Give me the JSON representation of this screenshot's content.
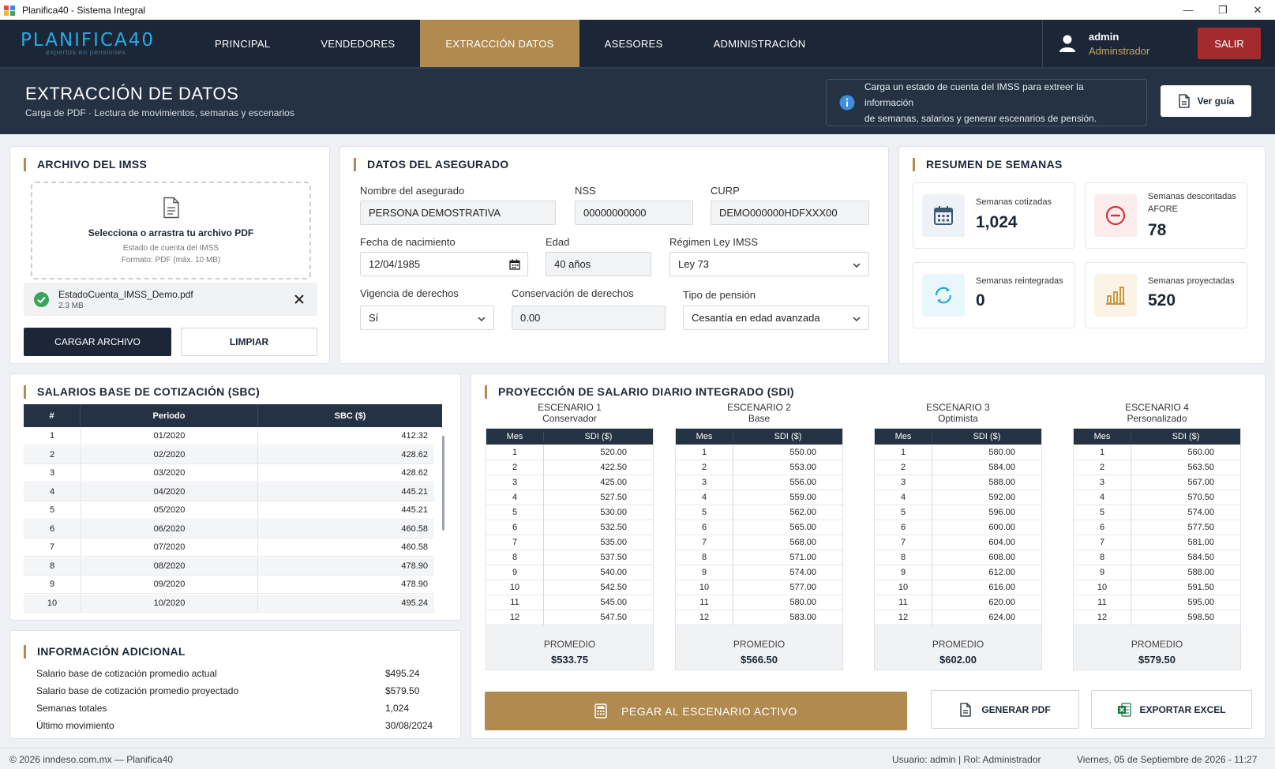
{
  "window": {
    "title": "Planifica40 - Sistema Integral",
    "controls": {
      "minimize": "—",
      "restore": "❐",
      "close": "✕"
    }
  },
  "nav": {
    "logo": "PLANIFICA40",
    "logo_tagline": "expertos en pensiones",
    "tabs": [
      "PRINCIPAL",
      "VENDEDORES",
      "EXTRACCIÓN DATOS",
      "ASESORES",
      "ADMINISTRACIÓN"
    ],
    "active_tab": "EXTRACCIÓN DATOS",
    "user": {
      "name": "admin",
      "role": "Adminstrador"
    },
    "logout_label": "SALIR"
  },
  "header": {
    "title": "EXTRACCIÓN DE DATOS",
    "subtitle": "Carga de PDF · Lectura de movimientos, semanas y escenarios",
    "info_line1": "Carga un estado de cuenta del IMSS para extreer la información",
    "info_line2": "de semanas, salarios y generar escenarios de pensión.",
    "guide_button": "Ver guía"
  },
  "archivo": {
    "title": "ARCHIVO DEL IMSS",
    "dropzone_title": "Selecciona o arrastra tu archivo PDF",
    "dropzone_line1": "Estado de cuenta del IMSS",
    "dropzone_line2": "Formato: PDF (máx. 10 MB)",
    "file_name": "EstadoCuenta_IMSS_Demo.pdf",
    "file_size": "2.3 MB",
    "upload_button": "CARGAR ARCHIVO",
    "clear_button": "LIMPIAR"
  },
  "asegurado": {
    "title": "DATOS DEL ASEGURADO",
    "nombre_label": "Nombre del asegurado",
    "nombre": "PERSONA DEMOSTRATIVA",
    "nss_label": "NSS",
    "nss": "00000000000",
    "curp_label": "CURP",
    "curp": "DEMO000000HDFXXX00",
    "fecha_label": "Fecha de nacimiento",
    "fecha": "12/04/1985",
    "edad_label": "Edad",
    "edad": "40 años",
    "regimen_label": "Régimen Ley IMSS",
    "regimen": "Ley 73",
    "vigencia_label": "Vigencia de derechos",
    "vigencia": "Sí",
    "conservacion_label": "Conservación de derechos",
    "conservacion": "0.00",
    "tipo_label": "Tipo de pensión",
    "tipo": "Cesantía en edad avanzada"
  },
  "resumen": {
    "title": "RESUMEN DE SEMANAS",
    "stats": [
      {
        "label": "Semanas cotizadas",
        "value": "1,024",
        "icon": "calendar-icon",
        "color": "#3d5873"
      },
      {
        "label": "Semanas descontadas AFORE",
        "value": "78",
        "icon": "minus-circle-icon",
        "color": "#d6333b"
      },
      {
        "label": "Semanas reintegradas",
        "value": "0",
        "icon": "refresh-icon",
        "color": "#2aa9d6"
      },
      {
        "label": "Semanas proyectadas",
        "value": "520",
        "icon": "bar-chart-icon",
        "color": "#c99a3d"
      }
    ]
  },
  "sbc": {
    "title": "SALARIOS BASE DE COTIZACIÓN (SBC)",
    "columns": [
      "#",
      "Periodo",
      "SBC ($)"
    ],
    "rows": [
      [
        "1",
        "01/2020",
        "412.32"
      ],
      [
        "2",
        "02/2020",
        "428.62"
      ],
      [
        "3",
        "03/2020",
        "428.62"
      ],
      [
        "4",
        "04/2020",
        "445.21"
      ],
      [
        "5",
        "05/2020",
        "445.21"
      ],
      [
        "6",
        "06/2020",
        "460.58"
      ],
      [
        "7",
        "07/2020",
        "460.58"
      ],
      [
        "8",
        "08/2020",
        "478.90"
      ],
      [
        "9",
        "09/2020",
        "478.90"
      ],
      [
        "10",
        "10/2020",
        "495.24"
      ]
    ]
  },
  "info": {
    "title": "INFORMACIÓN ADICIONAL",
    "rows": [
      [
        "Salario base de cotización promedio actual",
        "$495.24"
      ],
      [
        "Salario base de cotización promedio proyectado",
        "$579.50"
      ],
      [
        "Semanas totales",
        "1,024"
      ],
      [
        "Último movimiento",
        "30/08/2024"
      ]
    ]
  },
  "proyeccion": {
    "title": "PROYECCIÓN DE SALARIO DIARIO INTEGRADO (SDI)",
    "columns": [
      "Mes",
      "SDI ($)"
    ],
    "promedio_label": "PROMEDIO",
    "escenarios": [
      {
        "name": "ESCENARIO 1",
        "sub": "Conservador",
        "values": [
          "520.00",
          "422.50",
          "425.00",
          "527.50",
          "530.00",
          "532.50",
          "535.00",
          "537.50",
          "540.00",
          "542.50",
          "545.00",
          "547.50"
        ],
        "promedio": "$533.75"
      },
      {
        "name": "ESCENARIO 2",
        "sub": "Base",
        "values": [
          "550.00",
          "553.00",
          "556.00",
          "559.00",
          "562.00",
          "565.00",
          "568.00",
          "571.00",
          "574.00",
          "577.00",
          "580.00",
          "583.00"
        ],
        "promedio": "$566.50"
      },
      {
        "name": "ESCENARIO 3",
        "sub": "Optimista",
        "values": [
          "580.00",
          "584.00",
          "588.00",
          "592.00",
          "596.00",
          "600.00",
          "604.00",
          "608.00",
          "612.00",
          "616.00",
          "620.00",
          "624.00"
        ],
        "promedio": "$602.00"
      },
      {
        "name": "ESCENARIO 4",
        "sub": "Personalizado",
        "values": [
          "560.00",
          "563.50",
          "567.00",
          "570.50",
          "574.00",
          "577.50",
          "581.00",
          "584.50",
          "588.00",
          "591.50",
          "595.00",
          "598.50"
        ],
        "promedio": "$579.50"
      }
    ],
    "paste_button": "PEGAR AL ESCENARIO ACTIVO",
    "pdf_button": "GENERAR PDF",
    "excel_button": "EXPORTAR EXCEL"
  },
  "footer": {
    "copyright": "© 2026 inndeso.com.mx — Planifica40",
    "session": "Usuario: admin | Rol: Administrador",
    "datetime": "Viernes, 05 de Septiembre de 2026 - 11:27"
  }
}
